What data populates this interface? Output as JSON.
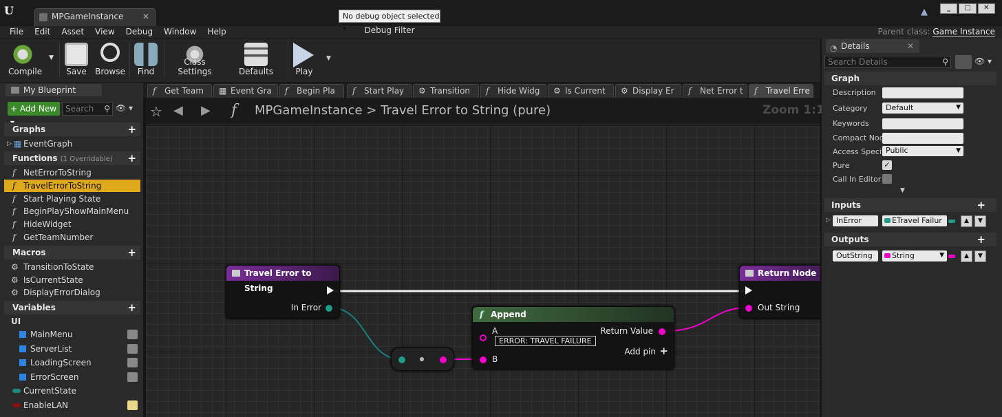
{
  "window": {
    "doc_tab": "MPGameInstance",
    "parent_class_label": "Parent class:",
    "parent_class_value": "Game Instance"
  },
  "menu": [
    "File",
    "Edit",
    "Asset",
    "View",
    "Debug",
    "Window",
    "Help"
  ],
  "toolbar": {
    "compile": "Compile",
    "save": "Save",
    "browse": "Browse",
    "find": "Find",
    "class_settings": "Class Settings",
    "class_defaults": "Class Defaults",
    "play": "Play",
    "debug_object": "No debug object selected",
    "debug_filter": "Debug Filter"
  },
  "my_blueprint": {
    "tab": "My Blueprint",
    "add_new": "+ Add New",
    "search_placeholder": "Search",
    "graphs_header": "Graphs",
    "graphs": [
      "EventGraph"
    ],
    "functions_header": "Functions",
    "functions_note": "(1 Overridable)",
    "functions": [
      "NetErrorToString",
      "TravelErrorToString",
      "Start Playing State",
      "BeginPlayShowMainMenu",
      "HideWidget",
      "GetTeamNumber"
    ],
    "selected_function": "TravelErrorToString",
    "macros_header": "Macros",
    "macros": [
      "TransitionToState",
      "IsCurrentState",
      "DisplayErrorDialog"
    ],
    "variables_header": "Variables",
    "ui_category": "UI",
    "ui_variables": [
      "MainMenu",
      "ServerList",
      "LoadingScreen",
      "ErrorScreen"
    ],
    "other_variables": [
      {
        "name": "CurrentState",
        "color": "#1b8c7c"
      },
      {
        "name": "EnableLAN",
        "color": "#8a1010"
      }
    ]
  },
  "graph_tabs": [
    "Get Team",
    "Event Gra",
    "Begin Pla",
    "Start Play",
    "Transition",
    "Hide Widg",
    "Is Current",
    "Display Er",
    "Net Error t",
    "Travel Erre"
  ],
  "graph": {
    "breadcrumb_root": "MPGameInstance",
    "breadcrumb_sep": ">",
    "breadcrumb_current": "Travel Error to String (pure)",
    "zoom": "Zoom 1:1",
    "entry_node": {
      "title": "Travel Error to String",
      "pin_in_error": "In Error"
    },
    "append_node": {
      "title": "Append",
      "pin_a": "A",
      "a_value": "ERROR: TRAVEL FAILURE",
      "pin_b": "B",
      "return_value": "Return Value",
      "add_pin": "Add pin"
    },
    "return_node": {
      "title": "Return Node",
      "pin_out_string": "Out String"
    }
  },
  "details": {
    "tab": "Details",
    "search_placeholder": "Search Details",
    "graph_header": "Graph",
    "description_label": "Description",
    "category_label": "Category",
    "category_value": "Default",
    "keywords_label": "Keywords",
    "compact_label": "Compact Node",
    "access_label": "Access Specif",
    "access_value": "Public",
    "pure_label": "Pure",
    "call_in_editor_label": "Call In Editor",
    "inputs_header": "Inputs",
    "input_name": "InError",
    "input_type": "ETravel Failur",
    "outputs_header": "Outputs",
    "output_name": "OutString",
    "output_type": "String"
  },
  "colors": {
    "selected": "#e0a81d",
    "enum_pin": "#1f9b87",
    "string_pin": "#f000c8",
    "function_header": "#7a2d98",
    "append_header": "#3a5a3a"
  }
}
